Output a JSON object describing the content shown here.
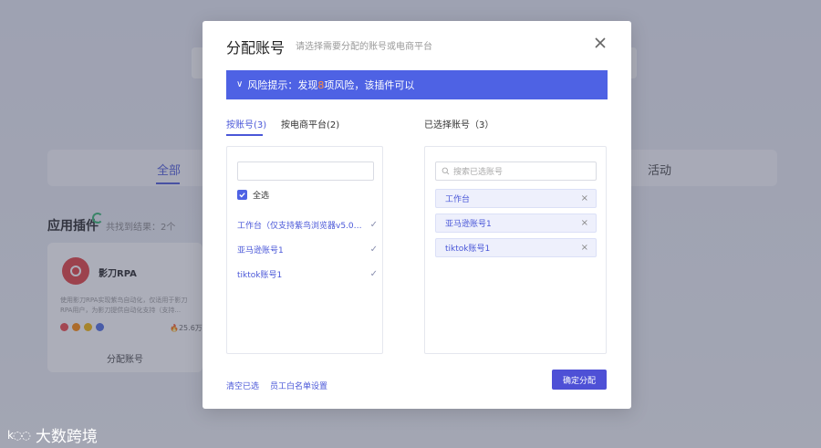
{
  "background": {
    "tabs": [
      {
        "label": "全部"
      },
      {
        "label": "活动"
      }
    ],
    "section_title": "应用插件",
    "section_sub": "共找到结果：2个",
    "card": {
      "name": "影刀RPA",
      "description": "使用影刀RPA实现紫鸟自动化，仅适用于影刀RPA用户，为影刀提供自动化支持（支持...",
      "count": "25.6万",
      "button": "分配账号"
    },
    "watermark": "大数跨境"
  },
  "modal": {
    "title": "分配账号",
    "subtitle": "请选择需要分配的账号或电商平台",
    "risk_prefix": "风险提示：发现",
    "risk_count": "8",
    "risk_suffix": "项风险，该插件可以",
    "tabs": [
      {
        "label": "按账号(3)"
      },
      {
        "label": "按电商平台(2)"
      }
    ],
    "selected_title": "已选择账号（3）",
    "search_value": "",
    "select_all_label": "全选",
    "accounts": [
      {
        "label": "工作台（仅支持紫鸟浏览器v5.0系..."
      },
      {
        "label": "亚马逊账号1"
      },
      {
        "label": "tiktok账号1"
      }
    ],
    "right_search_placeholder": "搜索已选账号",
    "selected": [
      {
        "label": "工作台"
      },
      {
        "label": "亚马逊账号1"
      },
      {
        "label": "tiktok账号1"
      }
    ],
    "clear_label": "清空已选",
    "whitelist_label": "员工白名单设置",
    "confirm_label": "确定分配",
    "accent_color": "#4e62e4"
  }
}
